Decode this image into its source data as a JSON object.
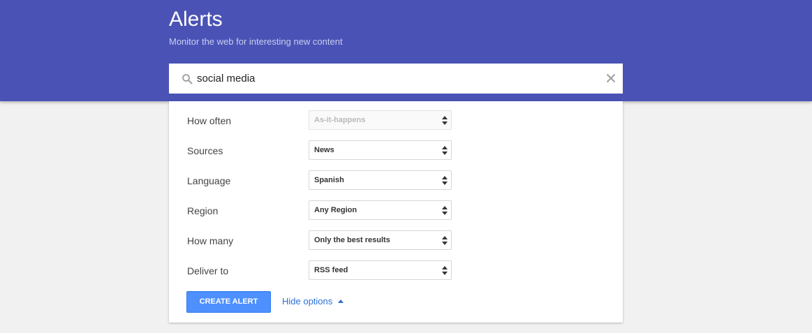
{
  "header": {
    "title": "Alerts",
    "subtitle": "Monitor the web for interesting new content",
    "background_color": "#4a53b5"
  },
  "search": {
    "value": "social media",
    "search_icon": "search-icon",
    "clear_icon": "close-icon"
  },
  "options": [
    {
      "label": "How often",
      "value": "As-it-happens",
      "disabled": true
    },
    {
      "label": "Sources",
      "value": "News",
      "disabled": false
    },
    {
      "label": "Language",
      "value": "Spanish",
      "disabled": false
    },
    {
      "label": "Region",
      "value": "Any Region",
      "disabled": false
    },
    {
      "label": "How many",
      "value": "Only the best results",
      "disabled": false
    },
    {
      "label": "Deliver to",
      "value": "RSS feed",
      "disabled": false
    }
  ],
  "actions": {
    "create_label": "CREATE ALERT",
    "create_color": "#4d90fe",
    "hide_options_label": "Hide options",
    "link_color": "#2a6fd6"
  }
}
